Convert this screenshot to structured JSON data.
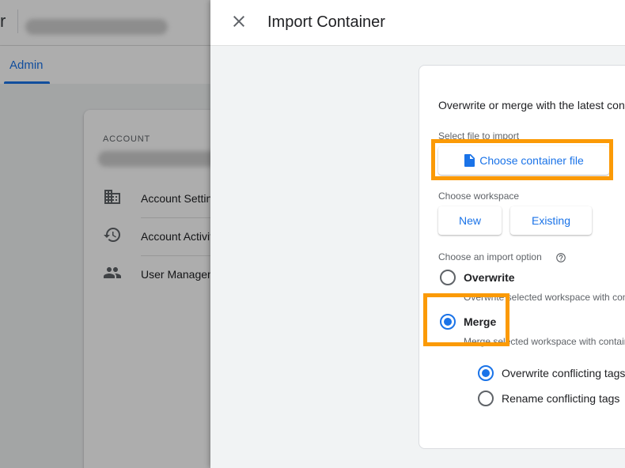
{
  "background": {
    "nav": {
      "admin_tab": "Admin"
    },
    "account": {
      "label": "ACCOUNT",
      "items": [
        {
          "label": "Account Settings",
          "icon": "building-icon"
        },
        {
          "label": "Account Activity",
          "icon": "history-icon"
        },
        {
          "label": "User Management",
          "icon": "people-icon"
        }
      ]
    }
  },
  "panel": {
    "title": "Import Container",
    "intro": "Overwrite or merge with the latest container",
    "select_file_label": "Select file to import",
    "choose_file_button": "Choose container file",
    "choose_workspace_label": "Choose workspace",
    "workspace_buttons": {
      "new": "New",
      "existing": "Existing"
    },
    "import_option_label": "Choose an import option",
    "options": [
      {
        "label": "Overwrite",
        "description": "Overwrite selected workspace with container",
        "checked": false
      },
      {
        "label": "Merge",
        "description": "Merge selected workspace with container",
        "checked": true
      }
    ],
    "merge_suboptions": [
      {
        "label": "Overwrite conflicting tags",
        "checked": true
      },
      {
        "label": "Rename conflicting tags",
        "checked": false
      }
    ]
  },
  "colors": {
    "accent": "#1a73e8",
    "highlight": "#fb9a06"
  }
}
